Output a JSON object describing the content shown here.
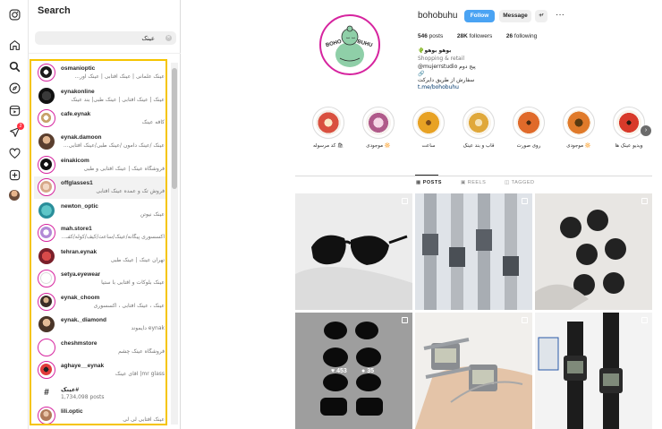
{
  "nav_rail": {
    "icons": [
      "instagram-icon",
      "home-icon",
      "search-icon",
      "explore-icon",
      "reels-icon",
      "messages-icon",
      "notifications-icon",
      "create-icon",
      "profile-avatar"
    ],
    "messages_badge": "2"
  },
  "search_panel": {
    "title": "Search",
    "query": "عینک",
    "results": [
      {
        "name": "osmanioptic",
        "sub": "عینک علمانی | عینک آفتابی | عینک اور..."
      },
      {
        "name": "eynakonline",
        "sub": "عینک | عینک آفتابی | عینک طبی| بند عینک"
      },
      {
        "name": "cafe.eynak",
        "sub": "کافه عینک"
      },
      {
        "name": "eynak.damoon",
        "sub": "عینک /عینک دامون /عینک طبی/عینک آفتابی..."
      },
      {
        "name": "einakicom",
        "sub": "فروشگاه عینک | عینک آفتابی و طبی"
      },
      {
        "name": "offglasses1",
        "sub": "فروش تک و عمده عینک آفتابی"
      },
      {
        "name": "newton_optic",
        "sub": "عینک نیوتن"
      },
      {
        "name": "mah.store1",
        "sub": "اکسسوری پیگانه/عینک/ساعت/کیف/کوله/کفـ..."
      },
      {
        "name": "tehran.eynak",
        "sub": "تهران عینک | عینک طبی"
      },
      {
        "name": "setya.eyewear",
        "sub": "عینک بلوکات و آفتابی با ستیا"
      },
      {
        "name": "eynak_choom",
        "sub": "عینک ، عینک آفتابی ، اکسسوری"
      },
      {
        "name": "eynak._diamond",
        "sub": "eynak دایموند"
      },
      {
        "name": "cheshmstore",
        "sub": "فروشگاه عینک چشم"
      },
      {
        "name": "aghaye__eynak",
        "sub": "mr glass| آقای عینک"
      },
      {
        "name": "#عینک",
        "sub": "1,734,098 posts"
      },
      {
        "name": "lili.optic",
        "sub": "عینک آفتابی لی لی"
      }
    ]
  },
  "profile": {
    "username": "bohobuhu",
    "follow_label": "Follow",
    "message_label": "Message",
    "add_label": "+ʳ",
    "more_label": "···",
    "posts_count": "546",
    "posts_label": "posts",
    "followers_count": "28K",
    "followers_label": "followers",
    "following_count": "26",
    "following_label": "following",
    "avatar_text_left": "BOHO",
    "avatar_text_right": "BUHU",
    "bio_name": "بوهو بوهو🌵",
    "bio_category": "Shopping & retail",
    "bio_line1": "@mujerrstudio پیج دوم",
    "bio_line2": "🔗",
    "bio_line3": "سفارش از طریق دایرکت",
    "bio_link": "t.me/bohobuhu"
  },
  "highlights": [
    {
      "label": "🛍 کد مرسوله",
      "color": "#d9503f"
    },
    {
      "label": "🔆 موجودی",
      "color": "#b05a8a"
    },
    {
      "label": "ساعت",
      "color": "#e8a224"
    },
    {
      "label": "قاب و بند عینک",
      "color": "#e0a83a"
    },
    {
      "label": "روی صورت",
      "color": "#e06a2a"
    },
    {
      "label": "🔆 موجودی",
      "color": "#e07a2a"
    },
    {
      "label": "ویدیو عینک ها",
      "color": "#d83a2a"
    }
  ],
  "tabs": [
    {
      "label": "POSTS",
      "active": true
    },
    {
      "label": "REELS",
      "active": false
    },
    {
      "label": "TAGGED",
      "active": false
    }
  ],
  "posts": [
    {
      "subject": "black cat-eye sunglasses"
    },
    {
      "subject": "digital wristwatches"
    },
    {
      "subject": "round sunglasses on linen"
    },
    {
      "subject": "stacked black sunglasses",
      "likes": "453",
      "comments": "35"
    },
    {
      "subject": "watches on wrist"
    },
    {
      "subject": "digital watches in box"
    }
  ]
}
